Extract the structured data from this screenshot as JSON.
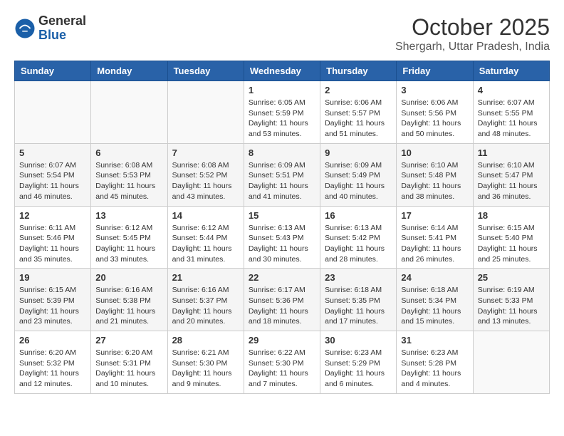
{
  "logo": {
    "general": "General",
    "blue": "Blue"
  },
  "title": "October 2025",
  "subtitle": "Shergarh, Uttar Pradesh, India",
  "weekdays": [
    "Sunday",
    "Monday",
    "Tuesday",
    "Wednesday",
    "Thursday",
    "Friday",
    "Saturday"
  ],
  "weeks": [
    [
      {
        "day": "",
        "info": ""
      },
      {
        "day": "",
        "info": ""
      },
      {
        "day": "",
        "info": ""
      },
      {
        "day": "1",
        "info": "Sunrise: 6:05 AM\nSunset: 5:59 PM\nDaylight: 11 hours and 53 minutes."
      },
      {
        "day": "2",
        "info": "Sunrise: 6:06 AM\nSunset: 5:57 PM\nDaylight: 11 hours and 51 minutes."
      },
      {
        "day": "3",
        "info": "Sunrise: 6:06 AM\nSunset: 5:56 PM\nDaylight: 11 hours and 50 minutes."
      },
      {
        "day": "4",
        "info": "Sunrise: 6:07 AM\nSunset: 5:55 PM\nDaylight: 11 hours and 48 minutes."
      }
    ],
    [
      {
        "day": "5",
        "info": "Sunrise: 6:07 AM\nSunset: 5:54 PM\nDaylight: 11 hours and 46 minutes."
      },
      {
        "day": "6",
        "info": "Sunrise: 6:08 AM\nSunset: 5:53 PM\nDaylight: 11 hours and 45 minutes."
      },
      {
        "day": "7",
        "info": "Sunrise: 6:08 AM\nSunset: 5:52 PM\nDaylight: 11 hours and 43 minutes."
      },
      {
        "day": "8",
        "info": "Sunrise: 6:09 AM\nSunset: 5:51 PM\nDaylight: 11 hours and 41 minutes."
      },
      {
        "day": "9",
        "info": "Sunrise: 6:09 AM\nSunset: 5:49 PM\nDaylight: 11 hours and 40 minutes."
      },
      {
        "day": "10",
        "info": "Sunrise: 6:10 AM\nSunset: 5:48 PM\nDaylight: 11 hours and 38 minutes."
      },
      {
        "day": "11",
        "info": "Sunrise: 6:10 AM\nSunset: 5:47 PM\nDaylight: 11 hours and 36 minutes."
      }
    ],
    [
      {
        "day": "12",
        "info": "Sunrise: 6:11 AM\nSunset: 5:46 PM\nDaylight: 11 hours and 35 minutes."
      },
      {
        "day": "13",
        "info": "Sunrise: 6:12 AM\nSunset: 5:45 PM\nDaylight: 11 hours and 33 minutes."
      },
      {
        "day": "14",
        "info": "Sunrise: 6:12 AM\nSunset: 5:44 PM\nDaylight: 11 hours and 31 minutes."
      },
      {
        "day": "15",
        "info": "Sunrise: 6:13 AM\nSunset: 5:43 PM\nDaylight: 11 hours and 30 minutes."
      },
      {
        "day": "16",
        "info": "Sunrise: 6:13 AM\nSunset: 5:42 PM\nDaylight: 11 hours and 28 minutes."
      },
      {
        "day": "17",
        "info": "Sunrise: 6:14 AM\nSunset: 5:41 PM\nDaylight: 11 hours and 26 minutes."
      },
      {
        "day": "18",
        "info": "Sunrise: 6:15 AM\nSunset: 5:40 PM\nDaylight: 11 hours and 25 minutes."
      }
    ],
    [
      {
        "day": "19",
        "info": "Sunrise: 6:15 AM\nSunset: 5:39 PM\nDaylight: 11 hours and 23 minutes."
      },
      {
        "day": "20",
        "info": "Sunrise: 6:16 AM\nSunset: 5:38 PM\nDaylight: 11 hours and 21 minutes."
      },
      {
        "day": "21",
        "info": "Sunrise: 6:16 AM\nSunset: 5:37 PM\nDaylight: 11 hours and 20 minutes."
      },
      {
        "day": "22",
        "info": "Sunrise: 6:17 AM\nSunset: 5:36 PM\nDaylight: 11 hours and 18 minutes."
      },
      {
        "day": "23",
        "info": "Sunrise: 6:18 AM\nSunset: 5:35 PM\nDaylight: 11 hours and 17 minutes."
      },
      {
        "day": "24",
        "info": "Sunrise: 6:18 AM\nSunset: 5:34 PM\nDaylight: 11 hours and 15 minutes."
      },
      {
        "day": "25",
        "info": "Sunrise: 6:19 AM\nSunset: 5:33 PM\nDaylight: 11 hours and 13 minutes."
      }
    ],
    [
      {
        "day": "26",
        "info": "Sunrise: 6:20 AM\nSunset: 5:32 PM\nDaylight: 11 hours and 12 minutes."
      },
      {
        "day": "27",
        "info": "Sunrise: 6:20 AM\nSunset: 5:31 PM\nDaylight: 11 hours and 10 minutes."
      },
      {
        "day": "28",
        "info": "Sunrise: 6:21 AM\nSunset: 5:30 PM\nDaylight: 11 hours and 9 minutes."
      },
      {
        "day": "29",
        "info": "Sunrise: 6:22 AM\nSunset: 5:30 PM\nDaylight: 11 hours and 7 minutes."
      },
      {
        "day": "30",
        "info": "Sunrise: 6:23 AM\nSunset: 5:29 PM\nDaylight: 11 hours and 6 minutes."
      },
      {
        "day": "31",
        "info": "Sunrise: 6:23 AM\nSunset: 5:28 PM\nDaylight: 11 hours and 4 minutes."
      },
      {
        "day": "",
        "info": ""
      }
    ]
  ]
}
